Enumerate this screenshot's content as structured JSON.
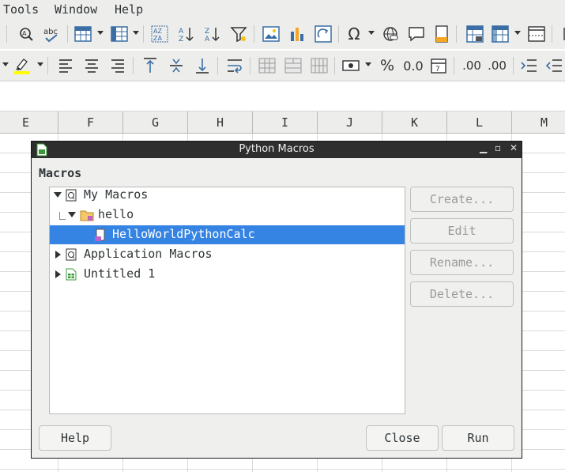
{
  "menubar": {
    "tools": "Tools",
    "window": "Window",
    "help": "Help"
  },
  "toolbar1": {
    "icons": [
      "spellcheck-icon",
      "autospell-icon",
      "row-icon",
      "column-icon",
      "sort-icon",
      "sort-ascending-icon",
      "sort-descending-icon",
      "autofilter-icon",
      "image-icon",
      "chart-icon",
      "pivot-table-icon",
      "special-character-icon",
      "hyperlink-icon",
      "comment-icon",
      "header-footer-icon",
      "define-print-area-icon",
      "freeze-rows-icon",
      "split-window-icon"
    ]
  },
  "toolbar2": {
    "percent": "%",
    "number": "0.0",
    "add_decimal": ".00",
    "remove_decimal": ".00"
  },
  "columns": [
    "E",
    "F",
    "G",
    "H",
    "I",
    "J",
    "K",
    "L",
    "M"
  ],
  "dialog": {
    "title": "Python Macros",
    "macros_label": "Macros",
    "tree": [
      {
        "label": "My Macros",
        "expanded": true
      },
      {
        "label": "hello",
        "expanded": true
      },
      {
        "label": "HelloWorldPythonCalc",
        "selected": true
      },
      {
        "label": "Application Macros",
        "expanded": false
      },
      {
        "label": "Untitled 1",
        "expanded": false
      }
    ],
    "buttons": {
      "create": "Create...",
      "edit": "Edit",
      "rename": "Rename...",
      "delete": "Delete...",
      "help": "Help",
      "close": "Close",
      "run": "Run"
    },
    "window_controls": {
      "minimize": "▁",
      "maximize": "▫",
      "close": "✕"
    }
  },
  "colors": {
    "selection": "#3584e4",
    "titlebar": "#2e2e2e",
    "accent": "#3a6ea5"
  }
}
